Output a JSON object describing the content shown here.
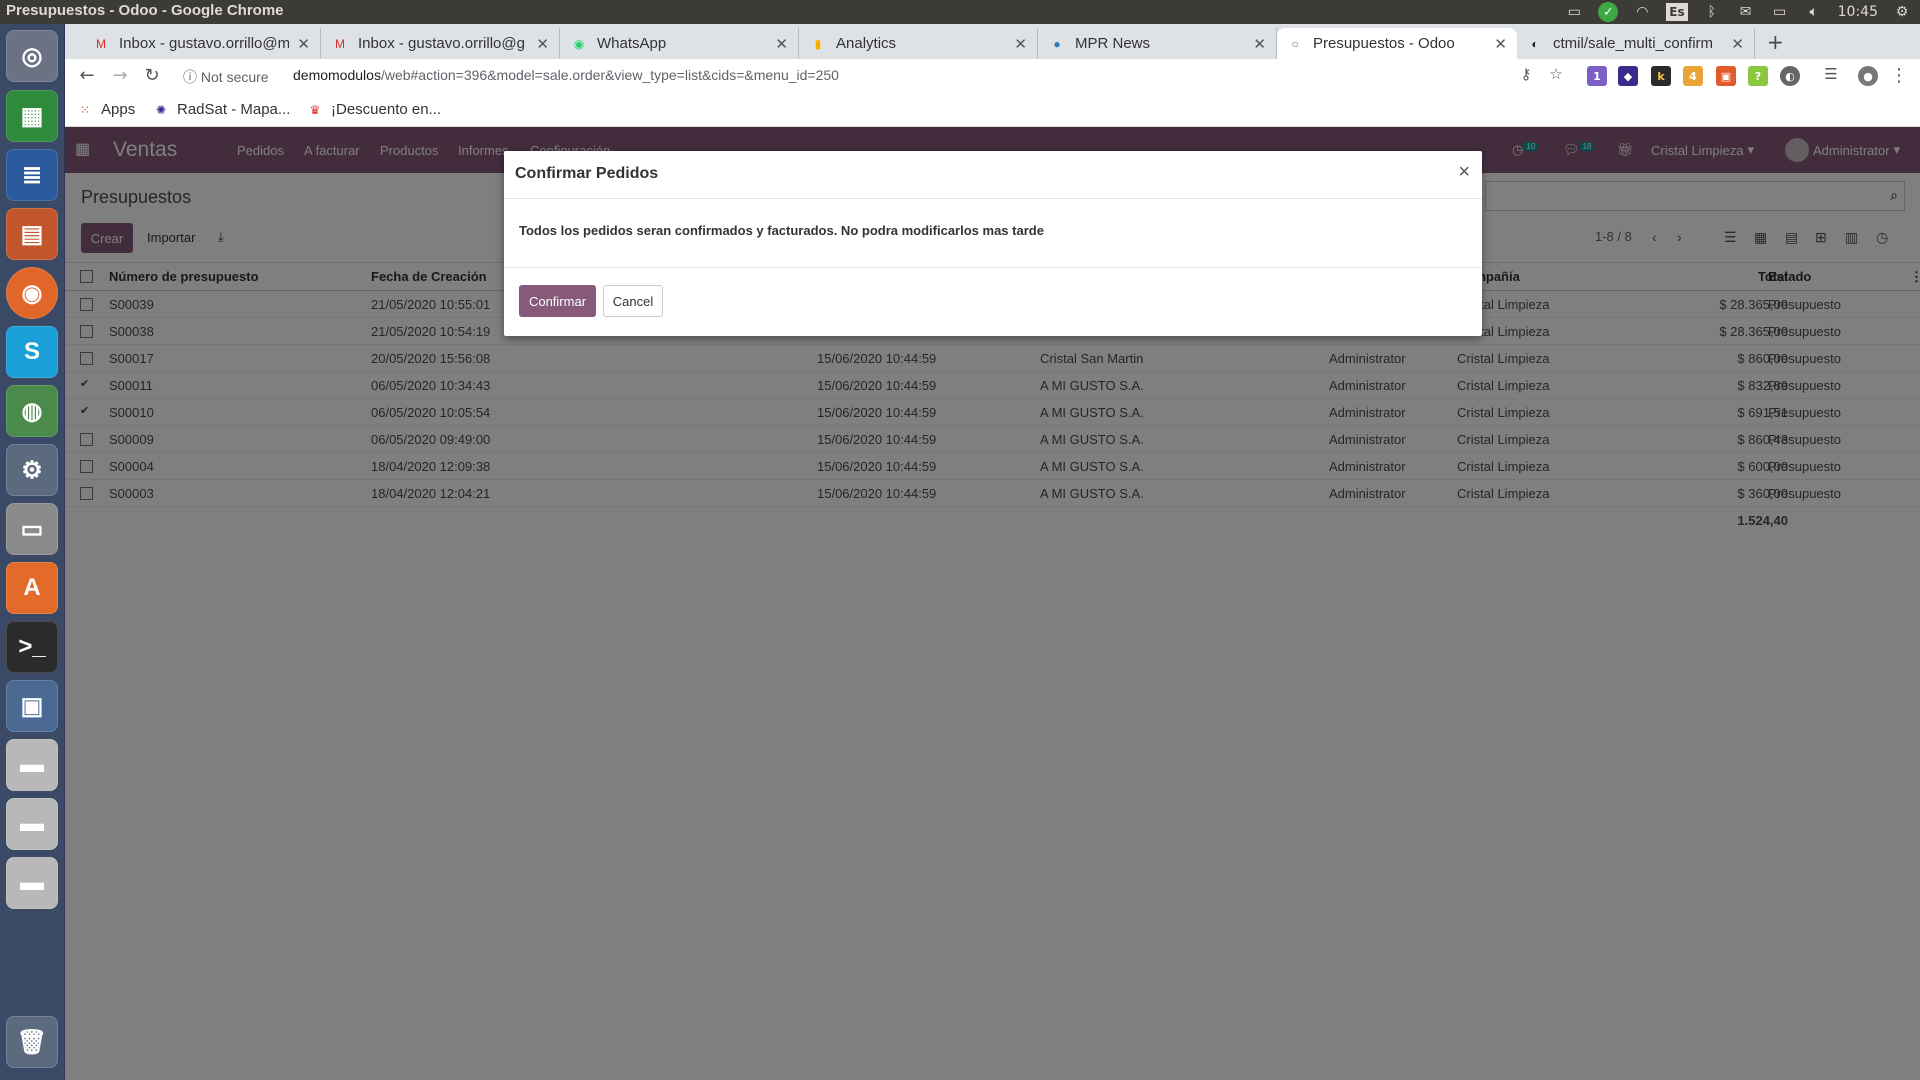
{
  "os": {
    "window_title": "Presupuestos - Odoo - Google Chrome",
    "keyboard_layout": "Es",
    "clock": "10:45"
  },
  "browser": {
    "tabs": [
      {
        "label": "Inbox - gustavo.orrillo@m",
        "icon": "gmail-icon"
      },
      {
        "label": "Inbox - gustavo.orrillo@g",
        "icon": "gmail-icon"
      },
      {
        "label": "WhatsApp",
        "icon": "whatsapp-icon"
      },
      {
        "label": "Analytics",
        "icon": "analytics-icon"
      },
      {
        "label": "MPR News",
        "icon": "news-icon"
      },
      {
        "label": "Presupuestos - Odoo",
        "icon": "odoo-icon",
        "active": true
      },
      {
        "label": "ctmil/sale_multi_confirm",
        "icon": "github-icon"
      }
    ],
    "security_label": "Not secure",
    "url_host": "demomodulos",
    "url_path": "/web#action=396&model=sale.order&view_type=list&cids=&menu_id=250",
    "bookmarks": [
      {
        "label": "Apps",
        "icon": "apps-grid-icon"
      },
      {
        "label": "RadSat - Mapa...",
        "icon": "radsat-icon"
      },
      {
        "label": "¡Descuento en...",
        "icon": "discount-icon"
      }
    ],
    "extension_badges": {
      "ext1": "1",
      "ext4": "4"
    }
  },
  "odoo": {
    "app_name": "Ventas",
    "menu": [
      "Pedidos",
      "A facturar",
      "Productos",
      "Informes",
      "Configuración"
    ],
    "activity_count": "10",
    "message_count": "18",
    "company": "Cristal Limpieza",
    "user": "Administrator",
    "breadcrumb": "Presupuestos",
    "create_label": "Crear",
    "import_label": "Importar",
    "pager": "1-8 / 8",
    "columns": {
      "number": "Número de presupuesto",
      "created": "Fecha de Creación",
      "company": "Compañía",
      "total": "Total",
      "state": "Estado"
    },
    "rows": [
      {
        "number": "S00039",
        "created": "21/05/2020 10:55:01",
        "date": "",
        "customer": "",
        "salesperson": "",
        "company": "Cristal Limpieza",
        "total": "$ 28.365,00",
        "state": "Presupuesto",
        "checked": false
      },
      {
        "number": "S00038",
        "created": "21/05/2020 10:54:19",
        "date": "",
        "customer": "",
        "salesperson": "",
        "company": "Cristal Limpieza",
        "total": "$ 28.365,00",
        "state": "Presupuesto",
        "checked": false
      },
      {
        "number": "S00017",
        "created": "20/05/2020 15:56:08",
        "date": "15/06/2020 10:44:59",
        "customer": "Cristal San Martin",
        "salesperson": "Administrator",
        "company": "Cristal Limpieza",
        "total": "$ 860,00",
        "state": "Presupuesto",
        "checked": false
      },
      {
        "number": "S00011",
        "created": "06/05/2020 10:34:43",
        "date": "15/06/2020 10:44:59",
        "customer": "A MI GUSTO S.A.",
        "salesperson": "Administrator",
        "company": "Cristal Limpieza",
        "total": "$ 832,89",
        "state": "Presupuesto",
        "checked": true
      },
      {
        "number": "S00010",
        "created": "06/05/2020 10:05:54",
        "date": "15/06/2020 10:44:59",
        "customer": "A MI GUSTO S.A.",
        "salesperson": "Administrator",
        "company": "Cristal Limpieza",
        "total": "$ 691,51",
        "state": "Presupuesto",
        "checked": true
      },
      {
        "number": "S00009",
        "created": "06/05/2020 09:49:00",
        "date": "15/06/2020 10:44:59",
        "customer": "A MI GUSTO S.A.",
        "salesperson": "Administrator",
        "company": "Cristal Limpieza",
        "total": "$ 860,43",
        "state": "Presupuesto",
        "checked": false
      },
      {
        "number": "S00004",
        "created": "18/04/2020 12:09:38",
        "date": "15/06/2020 10:44:59",
        "customer": "A MI GUSTO S.A.",
        "salesperson": "Administrator",
        "company": "Cristal Limpieza",
        "total": "$ 600,00",
        "state": "Presupuesto",
        "checked": false
      },
      {
        "number": "S00003",
        "created": "18/04/2020 12:04:21",
        "date": "15/06/2020 10:44:59",
        "customer": "A MI GUSTO S.A.",
        "salesperson": "Administrator",
        "company": "Cristal Limpieza",
        "total": "$ 360,00",
        "state": "Presupuesto",
        "checked": false
      }
    ],
    "sum_total": "1.524,40"
  },
  "modal": {
    "title": "Confirmar Pedidos",
    "close": "×",
    "body": "Todos los pedidos seran confirmados y facturados. No podra modificarlos mas tarde",
    "confirm_label": "Confirmar",
    "cancel_label": "Cancel"
  },
  "colors": {
    "odoo_primary": "#875a7b",
    "launcher": "#3a4a66",
    "topbar": "#3c3b37"
  }
}
